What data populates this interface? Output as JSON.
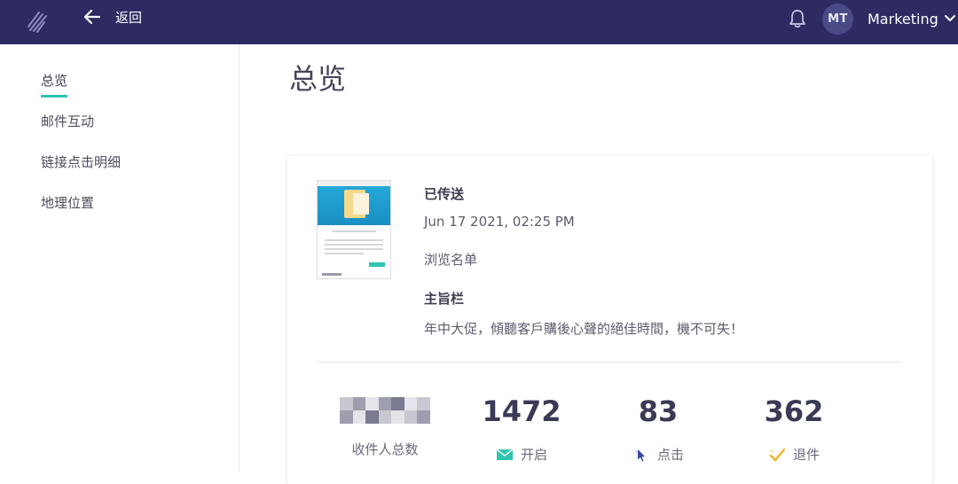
{
  "header": {
    "back_label": "返回",
    "avatar_initials": "MT",
    "account_name": "Marketing"
  },
  "sidebar": {
    "items": [
      {
        "label": "总览",
        "active": true
      },
      {
        "label": "邮件互动",
        "active": false
      },
      {
        "label": "链接点击明细",
        "active": false
      },
      {
        "label": "地理位置",
        "active": false
      }
    ]
  },
  "main": {
    "title": "总览",
    "campaign": {
      "status_label": "已传送",
      "sent_datetime": "Jun 17 2021, 02:25 PM",
      "list_name": "浏览名单",
      "subject_heading": "主旨栏",
      "subject": "年中大促，傾聽客戶購後心聲的絕佳時間，機不可失！"
    },
    "stats": [
      {
        "value": "",
        "label": "收件人总数",
        "icon": "redacted"
      },
      {
        "value": "1472",
        "label": "开启",
        "icon": "envelope-icon"
      },
      {
        "value": "83",
        "label": "点击",
        "icon": "cursor-icon"
      },
      {
        "value": "362",
        "label": "退件",
        "icon": "bounce-icon"
      }
    ]
  },
  "colors": {
    "topbar": "#2e2b63",
    "accent": "#2ec4b0",
    "click": "#3a4a9a",
    "bounce": "#f0b429"
  }
}
